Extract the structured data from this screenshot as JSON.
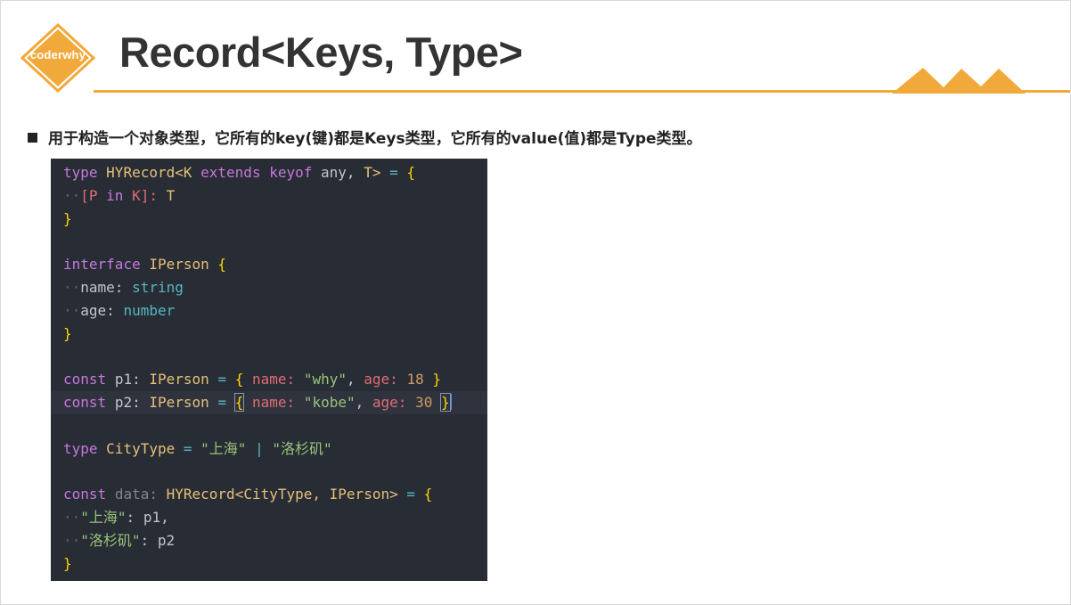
{
  "logo": {
    "text": "coderwhy",
    "color": "#f2a93b"
  },
  "title": "Record<Keys, Type>",
  "accent_color": "#f2a93b",
  "bullet": "用于构造一个对象类型，它所有的key(键)都是Keys类型，它所有的value(值)都是Type类型。",
  "code": {
    "l1": {
      "t1": "type",
      "t2": "HYRecord",
      "t3": "<K",
      "t4": "extends",
      "t5": "keyof",
      "t6": "any,",
      "t7": "T>",
      "t8": "=",
      "t9": "{"
    },
    "l2": {
      "t1": "[P",
      "t2": "in",
      "t3": "K]:",
      "t4": "T"
    },
    "l3": {
      "t1": "}"
    },
    "l5": {
      "t1": "interface",
      "t2": "IPerson",
      "t3": "{"
    },
    "l6": {
      "t1": "name:",
      "t2": "string"
    },
    "l7": {
      "t1": "age:",
      "t2": "number"
    },
    "l8": {
      "t1": "}"
    },
    "l10": {
      "t1": "const",
      "t2": "p1:",
      "t3": "IPerson",
      "t4": "=",
      "t5": "{",
      "t6": "name:",
      "t7": "\"why\"",
      "t8": ",",
      "t9": "age:",
      "t10": "18",
      "t11": "}"
    },
    "l11": {
      "t1": "const",
      "t2": "p2:",
      "t3": "IPerson",
      "t4": "=",
      "t5": "{",
      "t6": "name:",
      "t7": "\"kobe\"",
      "t8": ",",
      "t9": "age:",
      "t10": "30",
      "t11": "}"
    },
    "l13": {
      "t1": "type",
      "t2": "CityType",
      "t3": "=",
      "t4": "\"上海\"",
      "t5": "|",
      "t6": "\"洛杉矶\""
    },
    "l15": {
      "t1": "const",
      "t2": "data:",
      "t3": "HYRecord",
      "t4": "<CityType,",
      "t5": "IPerson>",
      "t6": "=",
      "t7": "{"
    },
    "l16": {
      "t1": "\"上海\"",
      "t2": ":",
      "t3": "p1,"
    },
    "l17": {
      "t1": "\"洛杉矶\"",
      "t2": ":",
      "t3": "p2"
    },
    "l18": {
      "t1": "}"
    }
  }
}
